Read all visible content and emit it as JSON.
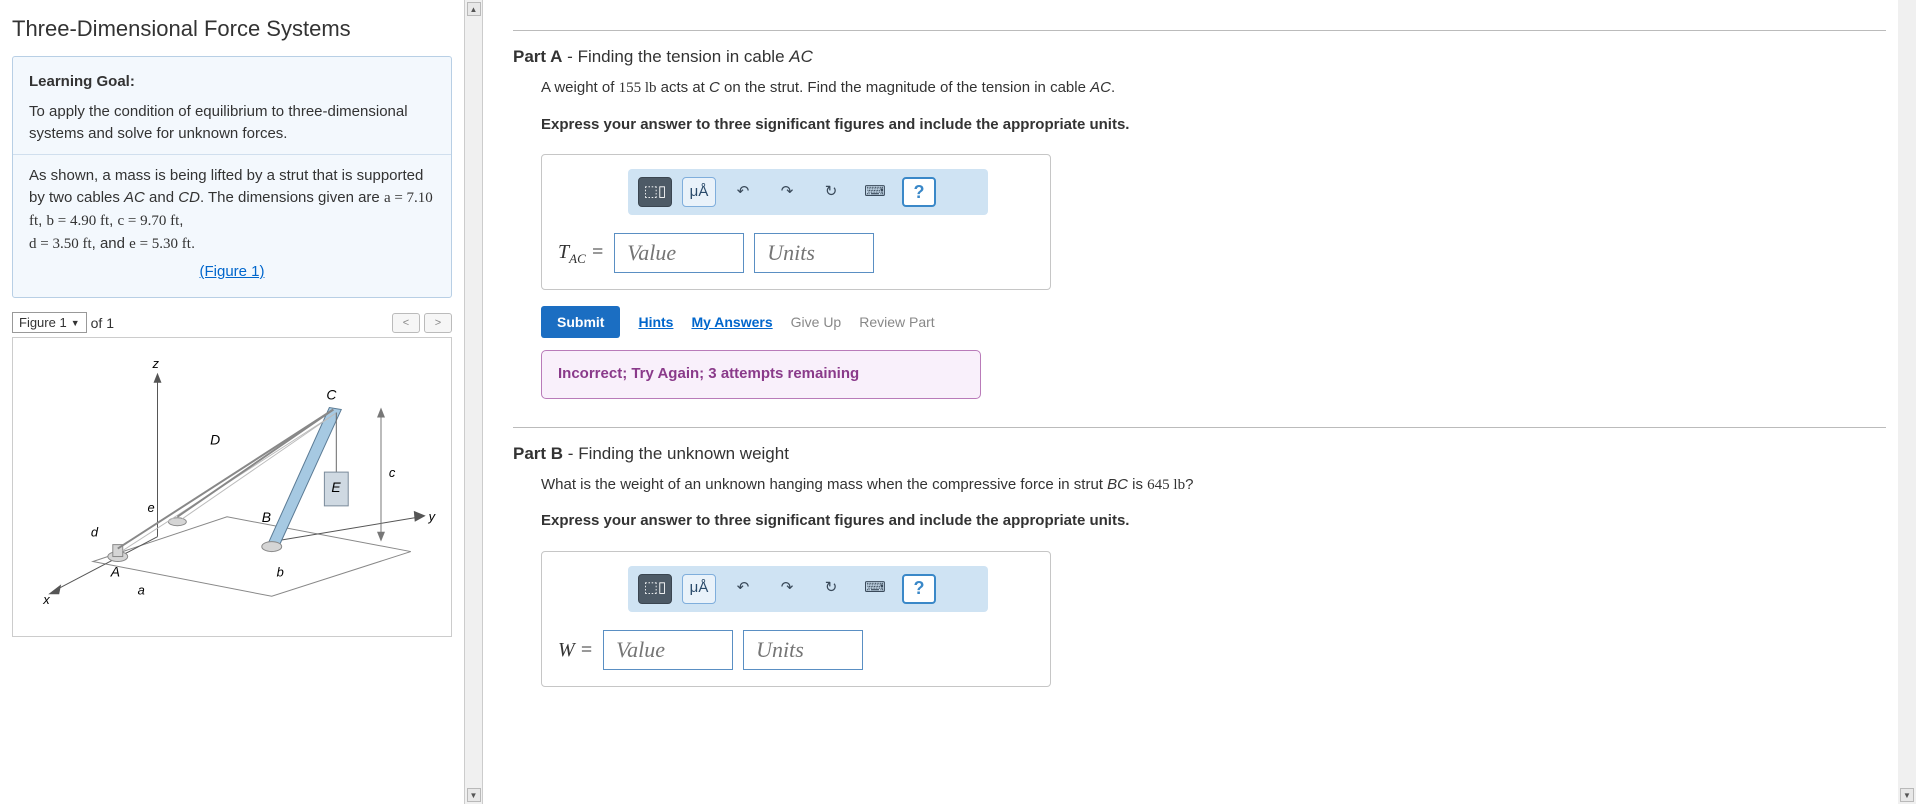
{
  "title": "Three-Dimensional Force Systems",
  "goal": {
    "heading": "Learning Goal:",
    "text1": "To apply the condition of equilibrium to three-dimensional systems and solve for unknown forces.",
    "text2_pre": "As shown, a mass is being lifted by a strut that is supported by two cables ",
    "text2_ac": "AC",
    "text2_and": " and ",
    "text2_cd": "CD",
    "text2_post": ". The dimensions given are ",
    "dim_a": "a = 7.10 ft",
    "dim_b": "b = 4.90 ft",
    "dim_c": "c = 9.70 ft",
    "dim_d": "d = 3.50 ft",
    "dim_e": "e = 5.30 ft",
    "figure_link": "(Figure 1)"
  },
  "figure_nav": {
    "selected": "Figure 1",
    "of_label": "of 1"
  },
  "figure_labels": {
    "A": "A",
    "B": "B",
    "C": "C",
    "D": "D",
    "E": "E",
    "a": "a",
    "b": "b",
    "c": "c",
    "d": "d",
    "e": "e",
    "x": "x",
    "y": "y",
    "z": "z"
  },
  "partA": {
    "label": "Part A",
    "sep": " - ",
    "subtitle": "Finding the tension in cable ",
    "cable": "AC",
    "q_pre": "A weight of ",
    "q_weight": "155 lb",
    "q_mid": " acts at ",
    "q_point": "C",
    "q_post": " on the strut. Find the magnitude of the tension in cable ",
    "q_cable": "AC",
    "q_end": ".",
    "instruction": "Express your answer to three significant figures and include the appropriate units.",
    "var_label": "T",
    "var_sub": "AC",
    "eq": " = ",
    "value_ph": "Value",
    "units_ph": "Units",
    "toolbar": {
      "templates": "⬚▯",
      "units": "μÅ",
      "undo": "↶",
      "redo": "↷",
      "reset": "↻",
      "keyboard": "⌨",
      "help": "?"
    },
    "submit": "Submit",
    "hints": "Hints",
    "my_answers": "My Answers",
    "give_up": "Give Up",
    "review": "Review Part",
    "feedback": "Incorrect; Try Again; 3 attempts remaining"
  },
  "partB": {
    "label": "Part B",
    "sep": " - ",
    "subtitle": "Finding the unknown weight",
    "q_pre": "What is the weight of an unknown hanging mass when the compressive force in strut ",
    "q_strut": "BC",
    "q_mid": " is ",
    "q_force": "645 lb",
    "q_end": "?",
    "instruction": "Express your answer to three significant figures and include the appropriate units.",
    "var_label": "W",
    "eq": " = ",
    "value_ph": "Value",
    "units_ph": "Units",
    "toolbar": {
      "templates": "⬚▯",
      "units": "μÅ",
      "undo": "↶",
      "redo": "↷",
      "reset": "↻",
      "keyboard": "⌨",
      "help": "?"
    }
  }
}
